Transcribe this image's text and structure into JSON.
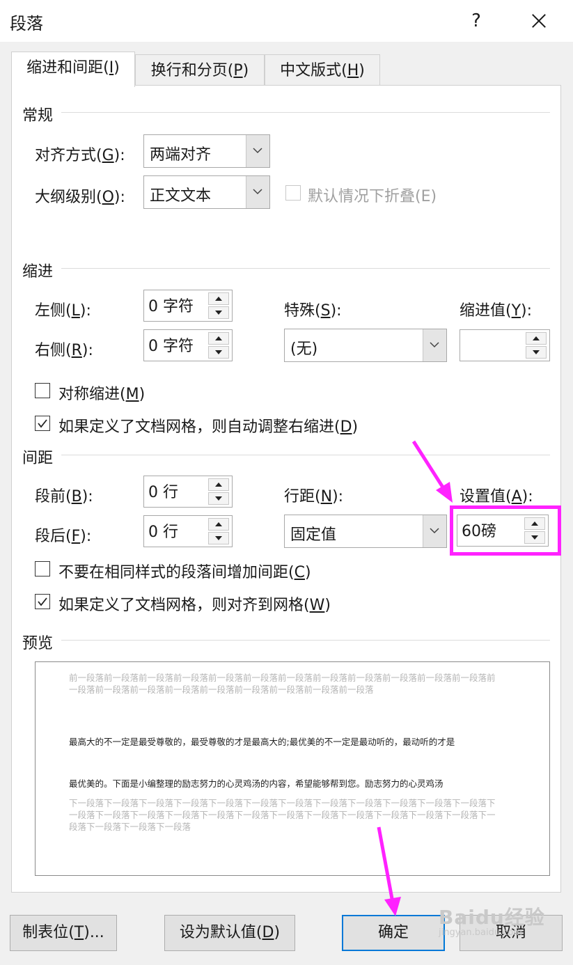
{
  "dialog": {
    "title": "段落",
    "help": "?",
    "accent": "#0078d7",
    "annotation_color": "#ff22ff"
  },
  "tabs": [
    {
      "label": "缩进和间距(I)",
      "text": "缩进和间距(",
      "key": "I",
      "tail": ")"
    },
    {
      "label": "换行和分页(P)",
      "text": "换行和分页(",
      "key": "P",
      "tail": ")"
    },
    {
      "label": "中文版式(H)",
      "text": "中文版式(",
      "key": "H",
      "tail": ")"
    }
  ],
  "general": {
    "heading": "常规",
    "alignment_label": {
      "text": "对齐方式(",
      "key": "G",
      "tail": "):"
    },
    "alignment_value": "两端对齐",
    "outline_label": {
      "text": "大纲级别(",
      "key": "O",
      "tail": "):"
    },
    "outline_value": "正文文本",
    "collapse_default": "默认情况下折叠(E)"
  },
  "indent": {
    "heading": "缩进",
    "left_label": {
      "text": "左侧(",
      "key": "L",
      "tail": "):"
    },
    "left_value": "0 字符",
    "right_label": {
      "text": "右侧(",
      "key": "R",
      "tail": "):"
    },
    "right_value": "0 字符",
    "special_label": {
      "text": "特殊(",
      "key": "S",
      "tail": "):"
    },
    "special_value": "(无)",
    "by_label": {
      "text": "缩进值(",
      "key": "Y",
      "tail": "):"
    },
    "by_value": "",
    "mirror": {
      "text": "对称缩进(",
      "key": "M",
      "tail": ")",
      "checked": false
    },
    "auto_adjust": {
      "text": "如果定义了文档网格，则自动调整右缩进(",
      "key": "D",
      "tail": ")",
      "checked": true
    }
  },
  "spacing": {
    "heading": "间距",
    "before_label": {
      "text": "段前(",
      "key": "B",
      "tail": "):"
    },
    "before_value": "0 行",
    "after_label": {
      "text": "段后(",
      "key": "F",
      "tail": "):"
    },
    "after_value": "0 行",
    "line_label": {
      "text": "行距(",
      "key": "N",
      "tail": "):"
    },
    "line_value": "固定值",
    "at_label": {
      "text": "设置值(",
      "key": "A",
      "tail": "):"
    },
    "at_value": "60磅",
    "no_space": {
      "text": "不要在相同样式的段落间增加间距(",
      "key": "C",
      "tail": ")",
      "checked": false
    },
    "snap_grid": {
      "text": "如果定义了文档网格，则对齐到网格(",
      "key": "W",
      "tail": ")",
      "checked": true
    }
  },
  "preview": {
    "heading": "预览",
    "before_text": "前一段落前一段落前一段落前一段落前一段落前一段落前一段落前一段落前一段落前一段落前一段落前一段落前一段落前一段落前一段落前一段落前一段落前一段落前一段落前一段落前一段落",
    "line1": "最高大的不一定是最受尊敬的，最受尊敬的才是最高大的;最优美的不一定是最动听的，最动听的才是",
    "line2": "最优美的。下面是小编整理的励志努力的心灵鸡汤的内容，希望能够帮到您。励志努力的心灵鸡汤",
    "after_text": "下一段落下一段落下一段落下一段落下一段落下一段落下一段落下一段落下一段落下一段落下一段落下一段落下一段落下一段落下一段落下一段落下一段落下一段落下一段落下一段落下一段落下一段落下一段落下一段落下一段落下一段落下一段落下一段落"
  },
  "buttons": {
    "tabs": {
      "text": "制表位(",
      "key": "T",
      "tail": ")..."
    },
    "default": {
      "text": "设为默认值(",
      "key": "D",
      "tail": ")"
    },
    "ok": "确定",
    "cancel": "取消"
  },
  "watermark": {
    "brand": "Baidu经验",
    "url": "jingyan.baidu.com"
  }
}
